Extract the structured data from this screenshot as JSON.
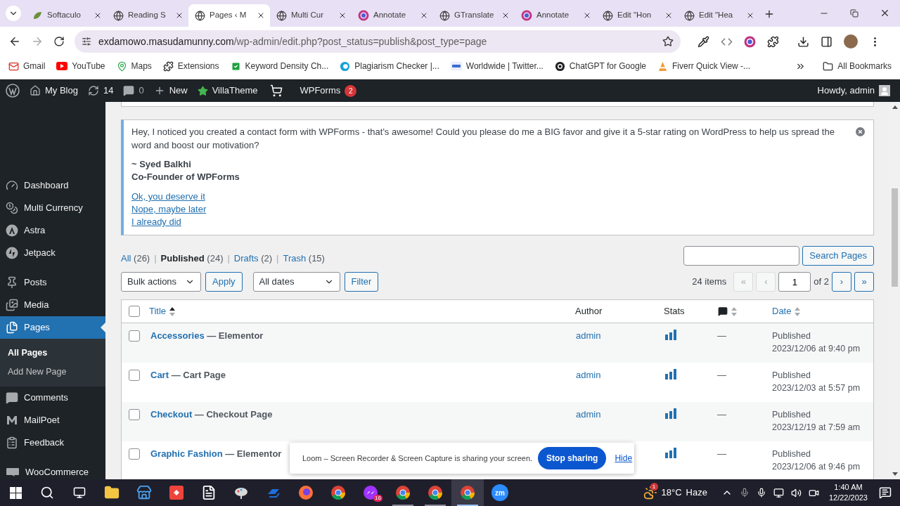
{
  "browser": {
    "tabs": [
      {
        "title": "Softaculo",
        "kind": "leaf",
        "selected": false
      },
      {
        "title": "Reading S",
        "kind": "globe",
        "selected": false
      },
      {
        "title": "Pages ‹ M",
        "kind": "globe",
        "selected": true
      },
      {
        "title": "Multi Cur",
        "kind": "globe",
        "selected": false
      },
      {
        "title": "Annotate",
        "kind": "ring",
        "selected": false
      },
      {
        "title": "GTranslate",
        "kind": "globe",
        "selected": false
      },
      {
        "title": "Annotate",
        "kind": "ring",
        "selected": false
      },
      {
        "title": "Edit \"Hon",
        "kind": "globe",
        "selected": false
      },
      {
        "title": "Edit \"Hea",
        "kind": "globe",
        "selected": false
      }
    ],
    "url": {
      "host": "exdamowo.masudamunny.com",
      "path": "/wp-admin/edit.php?post_status=publish&post_type=page"
    },
    "bookmarks": [
      {
        "label": "Gmail",
        "kind": "mail"
      },
      {
        "label": "YouTube",
        "kind": "play"
      },
      {
        "label": "Maps",
        "kind": "pin"
      },
      {
        "label": "Extensions",
        "kind": "puzzle"
      },
      {
        "label": "Keyword Density Ch...",
        "kind": "check"
      },
      {
        "label": "Plagiarism Checker |...",
        "kind": "circle"
      },
      {
        "label": "Worldwide | Twitter...",
        "kind": "news"
      },
      {
        "label": "ChatGPT for Google",
        "kind": "chat"
      },
      {
        "label": "Fiverr Quick View -...",
        "kind": "cone"
      }
    ],
    "all_bookmarks": "All Bookmarks"
  },
  "admin_bar": {
    "site": "My Blog",
    "updates": "14",
    "comments": "0",
    "new": "New",
    "villatheme": "VillaTheme",
    "wpforms": "WPForms",
    "wpforms_badge": "2",
    "howdy": "Howdy, admin"
  },
  "sidebar": {
    "groups": [
      {
        "items": [
          {
            "label": "Dashboard",
            "kind": "gauge",
            "selected": false
          },
          {
            "label": "Multi Currency",
            "kind": "coins",
            "selected": false
          },
          {
            "label": "Astra",
            "kind": "astra",
            "selected": false
          },
          {
            "label": "Jetpack",
            "kind": "jetpack",
            "selected": false
          }
        ]
      },
      {
        "items": [
          {
            "label": "Posts",
            "kind": "pin",
            "selected": false
          },
          {
            "label": "Media",
            "kind": "media",
            "selected": false
          },
          {
            "label": "Pages",
            "kind": "pages",
            "selected": true,
            "children": [
              {
                "label": "All Pages",
                "selected": true
              },
              {
                "label": "Add New Page",
                "selected": false
              }
            ]
          },
          {
            "label": "Comments",
            "kind": "comment",
            "selected": false
          },
          {
            "label": "MailPoet",
            "kind": "mailpoet",
            "selected": false
          },
          {
            "label": "Feedback",
            "kind": "feedback",
            "selected": false
          }
        ]
      },
      {
        "items": [
          {
            "label": "WooCommerce",
            "kind": "woo",
            "selected": false
          }
        ]
      }
    ]
  },
  "notice": {
    "message": "Hey, I noticed you created a contact form with WPForms - that's awesome! Could you please do me a BIG favor and give it a 5-star rating on WordPress to help us spread the word and boost our motivation?",
    "signature": "~ Syed Balkhi",
    "role": "Co-Founder of WPForms",
    "links": [
      "Ok, you deserve it",
      "Nope, maybe later",
      "I already did"
    ]
  },
  "views": [
    {
      "label": "All",
      "count": "(26)",
      "selected": false
    },
    {
      "separator": "|",
      "label": "Published",
      "count": "(24)",
      "selected": true
    },
    {
      "separator": "|",
      "label": "Drafts",
      "count": "(2)",
      "selected": false
    },
    {
      "separator": "|",
      "label": "Trash",
      "count": "(15)",
      "selected": false
    }
  ],
  "search": {
    "button": "Search Pages"
  },
  "bulk_actions": {
    "value": "Bulk actions",
    "button": "Apply"
  },
  "date_filter": {
    "value": "All dates",
    "button": "Filter"
  },
  "pagination": {
    "items": "24 items",
    "first": {
      "label": "«",
      "disabled": true
    },
    "prev": {
      "label": "‹",
      "disabled": true
    },
    "page": "1",
    "of": "of 2",
    "next": {
      "label": "›",
      "disabled": false
    },
    "last": {
      "label": "»",
      "disabled": false
    }
  },
  "table": {
    "select_all": false,
    "columns": [
      {
        "kind": "title",
        "label": "Title",
        "sortable": true,
        "sorted": true
      },
      {
        "kind": "author",
        "label": "Author",
        "sortable": false
      },
      {
        "kind": "stats",
        "label": "Stats",
        "sortable": false
      },
      {
        "kind": "comments",
        "sortable": true,
        "sorted": false
      },
      {
        "kind": "date",
        "label": "Date",
        "sortable": true,
        "sorted": false
      }
    ],
    "rows": [
      {
        "title": "Accessories",
        "state": "— Elementor",
        "author": "admin",
        "comments": "—",
        "status": "Published",
        "date": "2023/12/06 at 9:40 pm",
        "checked": false
      },
      {
        "title": "Cart",
        "state": "— Cart Page",
        "author": "admin",
        "comments": "—",
        "status": "Published",
        "date": "2023/12/03 at 5:57 pm",
        "checked": false
      },
      {
        "title": "Checkout",
        "state": "— Checkout Page",
        "author": "admin",
        "comments": "—",
        "status": "Published",
        "date": "2023/12/19 at 7:59 am",
        "checked": false
      },
      {
        "title": "Graphic Fashion",
        "state": "— Elementor",
        "comments": "—",
        "status": "Published",
        "date": "2023/12/06 at 9:46 pm",
        "checked": false
      }
    ]
  },
  "loom": {
    "message": "Loom – Screen Recorder & Screen Capture is sharing your screen.",
    "stop": "Stop sharing",
    "hide": "Hide"
  },
  "taskbar": {
    "apps": [
      {
        "kind": "folder",
        "selected": false,
        "running": false
      },
      {
        "kind": "store",
        "selected": false,
        "running": false
      },
      {
        "kind": "anydesk",
        "selected": false,
        "running": false
      },
      {
        "kind": "file",
        "selected": false,
        "running": false
      },
      {
        "kind": "paint",
        "selected": false,
        "running": false
      },
      {
        "kind": "remote",
        "selected": false,
        "running": false
      },
      {
        "kind": "firefox",
        "selected": false,
        "running": false
      },
      {
        "kind": "chrome",
        "selected": false,
        "running": false
      },
      {
        "kind": "messenger",
        "badge": "16",
        "selected": false,
        "running": false
      },
      {
        "kind": "chrome",
        "selected": false,
        "running": true
      },
      {
        "kind": "chrome",
        "selected": false,
        "running": true
      },
      {
        "kind": "chrome",
        "selected": true,
        "running": true
      },
      {
        "kind": "zoom",
        "label": "zm",
        "selected": false,
        "running": false
      }
    ],
    "weather": {
      "badge": "1",
      "temp": "18°C",
      "condition": "Haze"
    },
    "time": "1:40 AM",
    "date": "12/22/2023"
  }
}
